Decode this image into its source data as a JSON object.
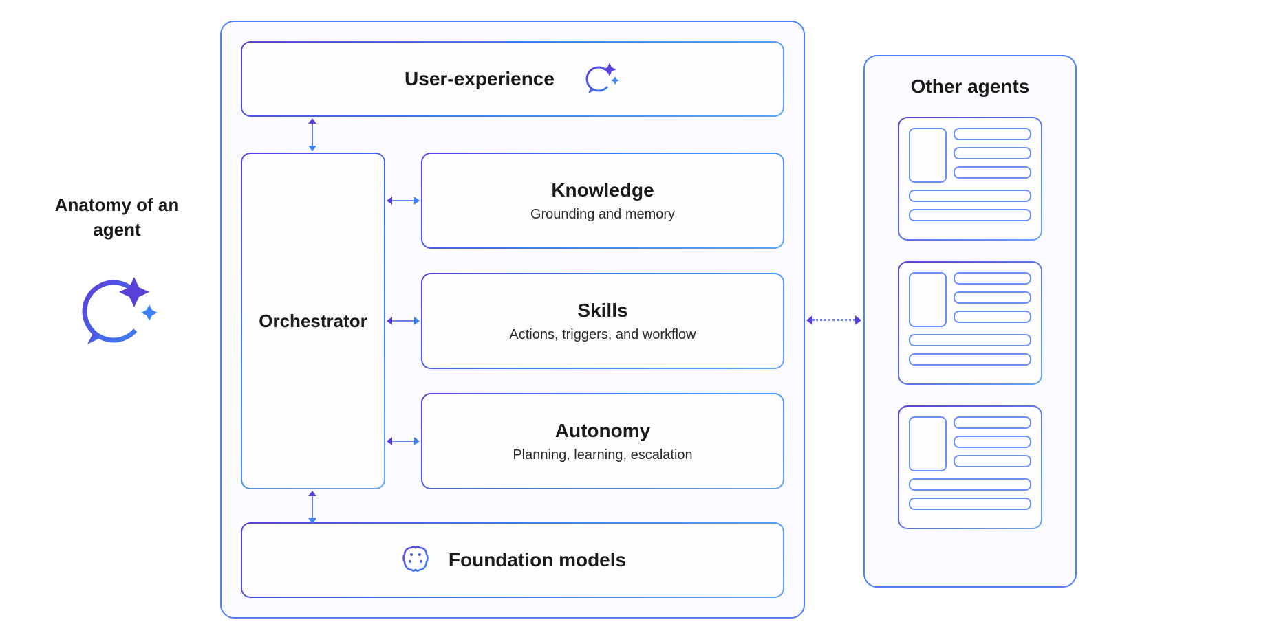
{
  "left_label": {
    "title": "Anatomy of an agent"
  },
  "main": {
    "user_experience": {
      "title": "User-experience"
    },
    "orchestrator": {
      "title": "Orchestrator"
    },
    "knowledge": {
      "title": "Knowledge",
      "subtitle": "Grounding and memory"
    },
    "skills": {
      "title": "Skills",
      "subtitle": "Actions, triggers, and workflow"
    },
    "autonomy": {
      "title": "Autonomy",
      "subtitle": "Planning, learning, escalation"
    },
    "foundation": {
      "title": "Foundation models"
    }
  },
  "other_agents": {
    "title": "Other agents"
  },
  "colors": {
    "accent_purple": "#5a3fd8",
    "accent_blue": "#3b82f6",
    "border_blue": "#4f7fff",
    "bg_light": "#fbfbff"
  }
}
